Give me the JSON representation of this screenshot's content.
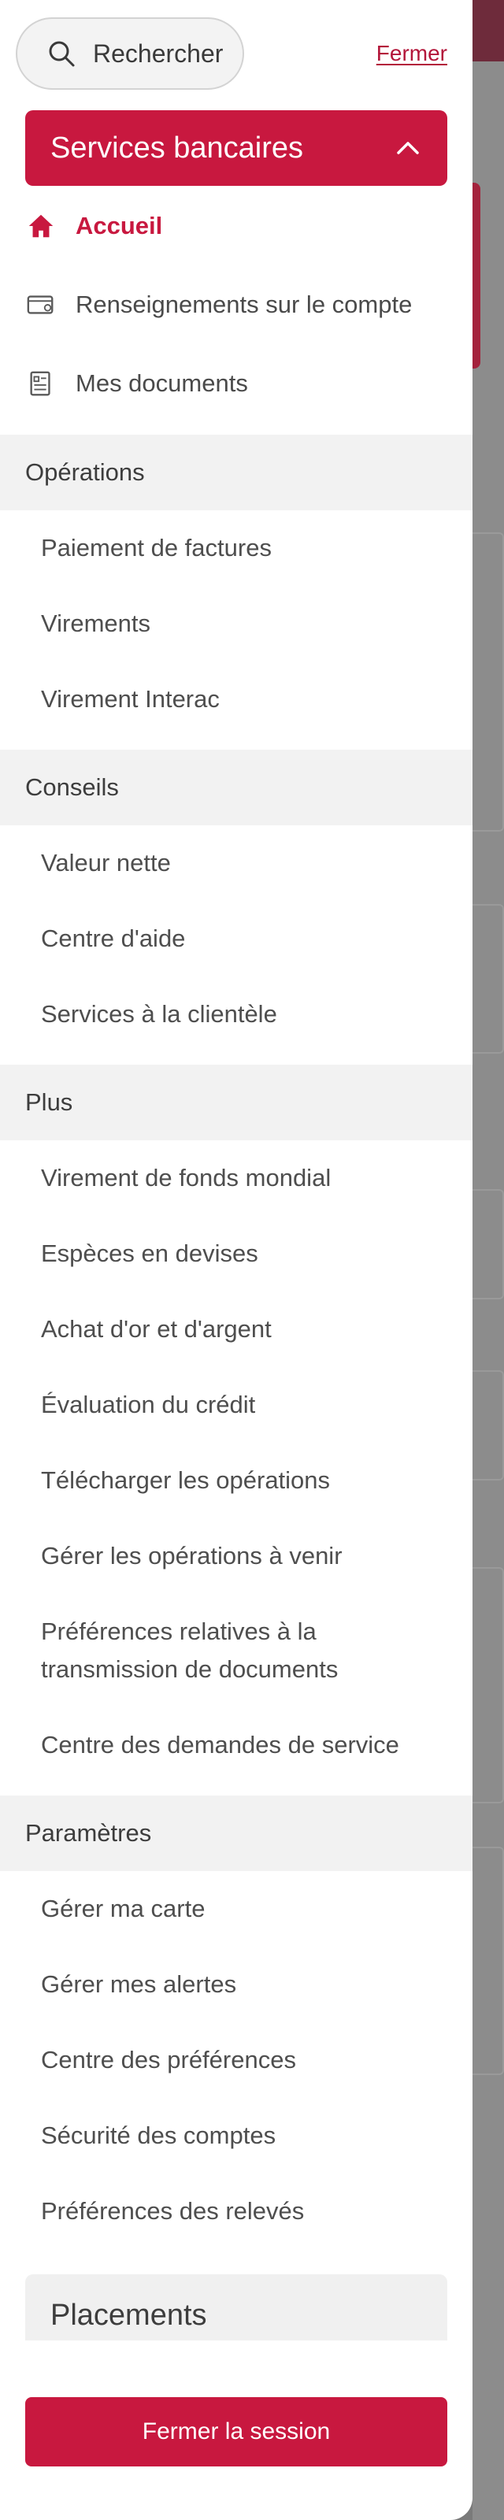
{
  "search": {
    "label": "Rechercher",
    "icon": "search-icon"
  },
  "close_label": "Fermer",
  "banking": {
    "title": "Services bancaires",
    "icon": "chevron-up-icon"
  },
  "main_items": [
    {
      "label": "Accueil",
      "icon": "home-icon",
      "active": true
    },
    {
      "label": "Renseignements sur le compte",
      "icon": "wallet-icon"
    },
    {
      "label": "Mes documents",
      "icon": "document-icon"
    }
  ],
  "groups": {
    "operations": {
      "title": "Opérations",
      "items": [
        "Paiement de factures",
        "Virements",
        "Virement Interac"
      ]
    },
    "conseils": {
      "title": "Conseils",
      "items": [
        "Valeur nette",
        "Centre d'aide",
        "Services à la clientèle"
      ]
    },
    "plus": {
      "title": "Plus",
      "items": [
        "Virement de fonds mondial",
        "Espèces en devises",
        "Achat d'or et d'argent",
        "Évaluation du crédit",
        "Télécharger les opérations",
        "Gérer les opérations à venir",
        "Préférences relatives à la transmission de documents",
        "Centre des demandes de service"
      ]
    },
    "parametres": {
      "title": "Paramètres",
      "items": [
        "Gérer ma carte",
        "Gérer mes alertes",
        "Centre des préférences",
        "Sécurité des comptes",
        "Préférences des relevés"
      ]
    }
  },
  "placements_title": "Placements",
  "logout_label": "Fermer la session",
  "colors": {
    "accent": "#c8183f",
    "group_bg": "#f2f2f2"
  }
}
